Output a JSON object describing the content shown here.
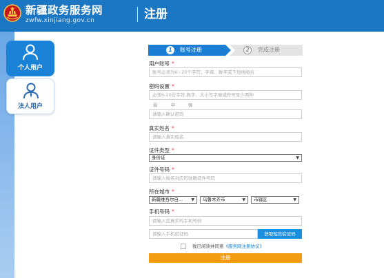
{
  "header": {
    "site_name": "新疆政务服务网",
    "site_domain": "zwfw.xinjiang.gov.cn",
    "page_title": "注册"
  },
  "user_tabs": [
    {
      "label": "个人用户",
      "selected": true
    },
    {
      "label": "法人用户",
      "selected": false
    }
  ],
  "steps": [
    {
      "number": "1",
      "label": "账号注册",
      "active": true
    },
    {
      "number": "2",
      "label": "完成注册",
      "active": false
    }
  ],
  "form": {
    "account": {
      "label": "用户账号",
      "placeholder": "账号必须为6~20个字符，字母、数字或下划线组合"
    },
    "password": {
      "label": "密码设置",
      "placeholder": "必须6-20位字符,数字、大小写字母或符号至少两种"
    },
    "strength": [
      "弱",
      "中",
      "强"
    ],
    "confirm": {
      "placeholder": "请输入确认密码"
    },
    "real_name": {
      "label": "真实姓名",
      "placeholder": "请输入真实姓名"
    },
    "id_type": {
      "label": "证件类型",
      "value": "身份证"
    },
    "id_number": {
      "label": "证件号码",
      "placeholder": "请输入姓名对应的准确证件号码"
    },
    "city": {
      "label": "所在城市",
      "region": "新疆维吾尔自...",
      "city": "乌鲁木齐市",
      "district": "市辖区"
    },
    "phone": {
      "label": "手机号码",
      "placeholder": "请输入您真实的手机号码"
    },
    "sms_code": {
      "placeholder": "请输入手机验证码",
      "button": "获取短信验证码"
    },
    "required_mark": "*",
    "agreement": {
      "prefix": "我已阅读并同意",
      "link": "《服务网注册协议》"
    },
    "submit": "注册"
  },
  "colors": {
    "header": "#1b76c4",
    "accent": "#1a7fd4",
    "submit": "#f39c12",
    "required": "#e53935"
  }
}
